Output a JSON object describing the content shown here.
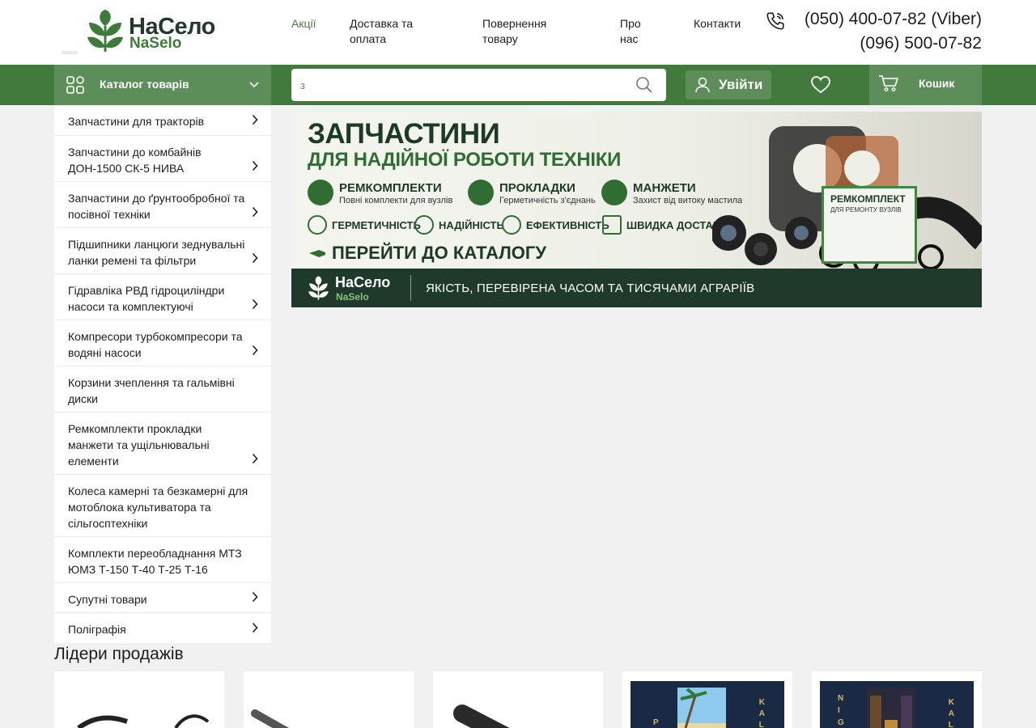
{
  "logo": {
    "ua": "НаСело",
    "en": "NaSelo"
  },
  "nav": [
    "Акції",
    "Доставка та оплата",
    "Повернення товару",
    "Про нас",
    "Контакти"
  ],
  "phones": [
    "(050) 400-07-82 (Viber)",
    "(096) 500-07-82"
  ],
  "toolbar": {
    "catalog_label": "Каталог товарів",
    "search_value": "з",
    "login_label": "Увійти",
    "cart_label": "Кошик"
  },
  "categories": [
    "Запчастини для тракторів",
    "Запчастини до комбайнів ДОН-1500 СК-5 НИВА",
    "Запчастини до ґрунтообробної та посівної техніки",
    "Підшипники ланцюги зеднувальні ланки ремені та фільтри",
    "Гідравліка РВД гідроциліндри насоси та комплектуючі",
    "Компресори турбокомпресори та водяні насоси",
    "Корзини зчеплення та гальмівні диски",
    "Ремкомплекти прокладки манжети та ущільнювальні елементи",
    "Колеса камерні та безкамерні для мотоблока культиватора та сільгосптехніки",
    "Комплекти переобладнання МТЗ ЮМЗ Т-150 Т-40 Т-25 Т-16",
    "Супутні товари",
    "Поліграфія"
  ],
  "banner": {
    "title1": "ЗАПЧАСТИНИ",
    "title2": "ДЛЯ НАДІЙНОЇ РОБОТИ ТЕХНІКИ",
    "features": [
      {
        "title": "РЕМКОМПЛЕКТИ",
        "subtitle": "Повні комплекти для вузлів"
      },
      {
        "title": "ПРОКЛАДКИ",
        "subtitle": "Герметичність з'єднань"
      },
      {
        "title": "МАНЖЕТИ",
        "subtitle": "Захист від витоку мастила"
      }
    ],
    "badges": [
      "ГЕРМЕТИЧНІСТЬ",
      "НАДІЙНІСТЬ",
      "ЕФЕКТИВНІСТЬ",
      "ШВИДКА ДОСТАВКА"
    ],
    "cta": "ПЕРЕЙТИ ДО КАТАЛОГУ",
    "kit_title": "РЕМКОМПЛЕКТ",
    "kit_subtitle": "ДЛЯ РЕМОНТУ ВУЗЛІВ",
    "footer_logo_ua": "НаСело",
    "footer_logo_en": "NaSelo",
    "slogan": "ЯКІСТЬ, ПЕРЕВІРЕНА ЧАСОМ ТА ТИСЯЧАМИ АГРАРІЇВ"
  },
  "leaders_title": "Лідери продажів",
  "colors": {
    "brand_green": "#427a3d",
    "light_green": "#5d8d59",
    "accent_text": "#4c7d44"
  },
  "icons": [
    "phone-icon",
    "grid-icon",
    "chevron-down-icon",
    "search-icon",
    "user-icon",
    "heart-icon",
    "cart-icon",
    "chevron-right-icon"
  ]
}
